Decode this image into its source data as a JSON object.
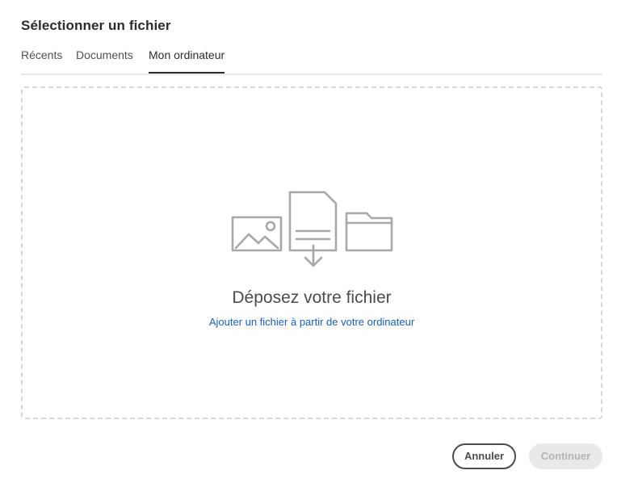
{
  "dialog": {
    "title": "Sélectionner un fichier"
  },
  "tabs": [
    {
      "label": "Récents",
      "active": false
    },
    {
      "label": "Documents",
      "active": false
    },
    {
      "label": "Mon ordinateur",
      "active": true
    }
  ],
  "dropzone": {
    "title": "Déposez votre fichier",
    "link": "Ajouter un fichier à partir de votre ordinateur",
    "icons": [
      "image-icon",
      "file-download-icon",
      "folder-icon"
    ]
  },
  "footer": {
    "cancel_label": "Annuler",
    "continue_label": "Continuer",
    "continue_disabled": true
  },
  "colors": {
    "link": "#1b5fb5",
    "icon_stroke": "#a8a8a8",
    "active_tab_underline": "#2c2c2c"
  }
}
